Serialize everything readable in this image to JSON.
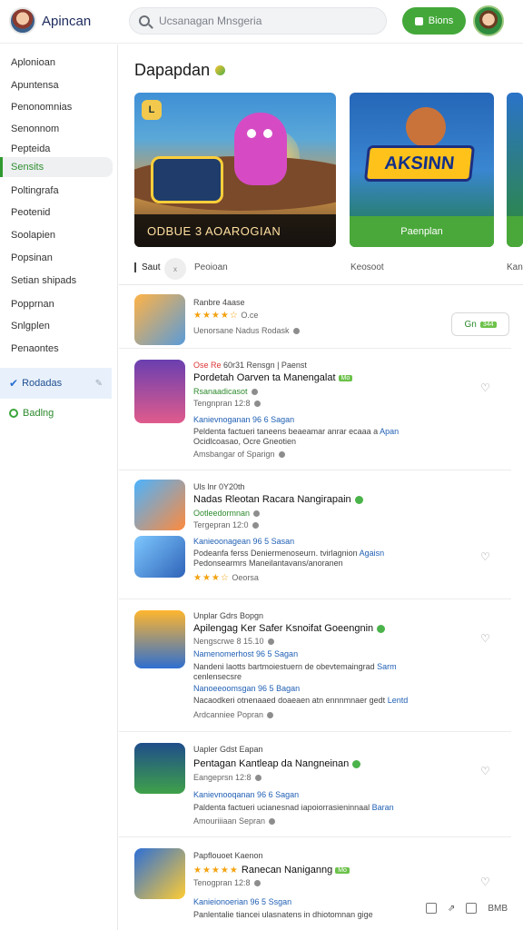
{
  "header": {
    "app_name": "Apincan",
    "search_placeholder": "Ucsanagan Mnsgeria",
    "cta_label": "Bions"
  },
  "sidebar": {
    "items": [
      {
        "label": "Aplonioan"
      },
      {
        "label": "Apuntensa"
      },
      {
        "label": "Penonomnias"
      },
      {
        "label": "Senonnom"
      },
      {
        "label": "Pepteida"
      },
      {
        "label": "Sensits",
        "active": true
      },
      {
        "label": "Poltingrafa"
      },
      {
        "label": "Peotenid"
      },
      {
        "label": "Soolapien"
      },
      {
        "label": "Popsinan"
      },
      {
        "label": "Setian shipads"
      },
      {
        "label": "Popprnan"
      },
      {
        "label": "Snlgplen"
      },
      {
        "label": "Penaontes"
      }
    ],
    "special": {
      "label": "Rodadas",
      "icon": "verified-icon"
    },
    "green_link": {
      "label": "Badlng",
      "icon": "ring-icon"
    }
  },
  "main": {
    "title": "Dapapdan",
    "featured": [
      {
        "caption": "ODBUE 3 AOAROGIAN",
        "badge": "L"
      },
      {
        "art_text": "AKSINN",
        "button": "Paenplan"
      },
      {}
    ],
    "filters": {
      "a": "Saut",
      "chip": "x",
      "b": "Peoioan",
      "c": "Keosoot",
      "d": "Kan"
    }
  },
  "feed": {
    "app": {
      "meta": "Ranbre 4aase",
      "rating_text": "O.ce",
      "rating_stars": "★★★★☆",
      "sub": "Uenorsane Nadus Rodask",
      "install_label": "Gn",
      "install_tag": "344"
    },
    "post1": {
      "meta_red": "Ose Re",
      "meta": "60r31 Rensgn | Paenst",
      "title": "Pordetah Oarven ta Manengalat",
      "tag": "Mo",
      "green": "Rsanaadicasot",
      "gray": "Tengnpran 12:8",
      "blue": "Kanievnoganan 96 6 Sagan",
      "body1": "Peldenta factueri taneens beaeamar anrar ecaaa a",
      "body1_link": "Apan",
      "body2": "Ocidlcoasao, Ocre Gneotien",
      "foot": "Amsbangar of Sparign"
    },
    "post2": {
      "meta": "Uls lnr 0Y20th",
      "title": "Nadas Rleotan Racara Nangirapain",
      "green": "Ootleedormnan",
      "gray": "Tergepran 12:0",
      "blue": "Kanieoonagean 96 5 Sasan",
      "body1": "Podeanfa ferss Deniermenoseurn. tvirlagnion",
      "body1_link": "Agaisn",
      "body2": "Pedonsearmrs Maneilantavans/anoranen",
      "rating_stars": "★★★☆",
      "rating_text": "Oeorsa"
    },
    "post3": {
      "meta": "Unplar Gdrs Bopgn",
      "title": "Apilengag Ker Safer Ksnoifat Goeengnin",
      "gray": "Nengscrwe 8 15.10",
      "blue": "Namenomerhost 96 5 Sagan",
      "body1": "Nandeni laotts bartmoiestuern de obevtemaingrad",
      "body1_link": "Sarm",
      "body2": "cenlensecsre",
      "blue2": "Nanoeeoomsgan 96 5 Bagan",
      "body3": "Nacaodkeri otnenaaed doaeaen atn ennnmnaer gedt",
      "body3_link": "Lentd",
      "foot": "Ardcanniee Popran"
    },
    "post4": {
      "meta": "Uapler Gdst Eapan",
      "title": "Pentagan Kantleap da Nangneinan",
      "gray": "Eangeprsn 12:8",
      "blue": "Kanievnooqanan 96 6 Sagan",
      "body1": "Paldenta factueri ucianesnad iapoiorrasieninnaal",
      "body1_link": "Baran",
      "foot": "Amouriiiaan Sepran"
    },
    "post5": {
      "meta": "Papflouoet Kaenon",
      "title": "Ranecan Naniganng",
      "tag": "Mo",
      "rating_stars": "★★★★★",
      "gray": "Tenogpran 12:8",
      "blue": "Kanieionoerian 96 5 Ssgan",
      "body1": "Panlentalie tiancei ulasnatens in dhiotomnan gige"
    },
    "bottom_tools": {
      "label": "BMB"
    }
  }
}
